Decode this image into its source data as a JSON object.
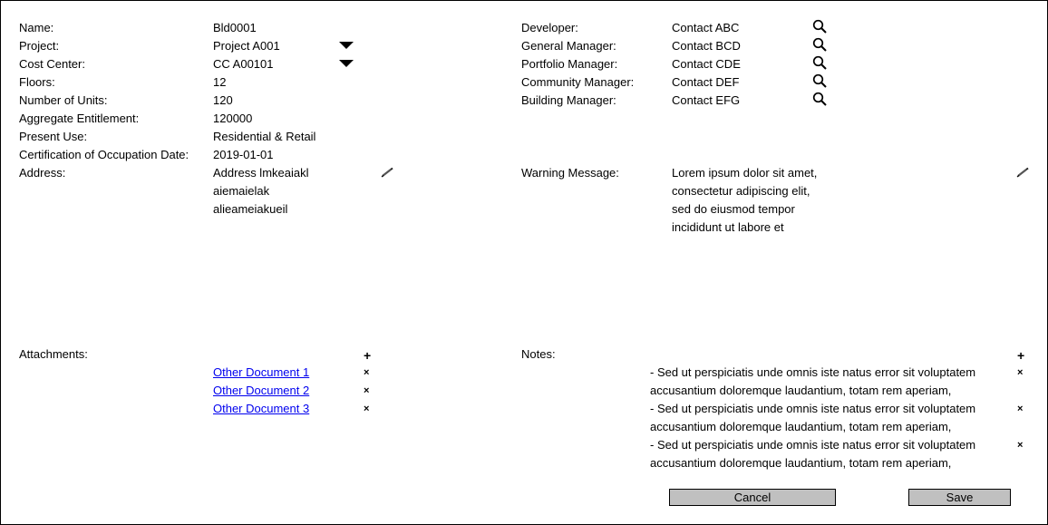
{
  "fields_left": [
    {
      "label": "Name:",
      "value": "Bld0001"
    },
    {
      "label": "Project:",
      "value": "Project A001"
    },
    {
      "label": "Cost Center:",
      "value": "CC A00101"
    },
    {
      "label": "Floors:",
      "value": "12"
    },
    {
      "label": "Number of Units:",
      "value": "120"
    },
    {
      "label": "Aggregate Entitlement:",
      "value": "120000"
    },
    {
      "label": "Present Use:",
      "value": "Residential & Retail"
    },
    {
      "label": "Certification of Occupation Date:",
      "value": "2019-01-01"
    }
  ],
  "address": {
    "label": "Address:",
    "lines": [
      "Address lmkeaiakl",
      "aiemaielak",
      "alieameiakueil"
    ]
  },
  "contacts": [
    {
      "label": "Developer:",
      "value": "Contact ABC",
      "icon": "search-icon"
    },
    {
      "label": "General Manager:",
      "value": "Contact BCD",
      "icon": "search-icon"
    },
    {
      "label": "Portfolio Manager:",
      "value": "Contact CDE",
      "icon": "search-icon"
    },
    {
      "label": "Community Manager:",
      "value": "Contact DEF",
      "icon": "search-icon"
    },
    {
      "label": "Building Manager:",
      "value": "Contact EFG",
      "icon": "search-icon"
    }
  ],
  "warning": {
    "label": "Warning Message:",
    "lines": [
      "Lorem ipsum dolor sit amet,",
      "consectetur adipiscing elit,",
      "sed do eiusmod tempor",
      "incididunt ut labore et"
    ]
  },
  "attachments": {
    "label": "Attachments:",
    "add_symbol": "+",
    "remove_symbol": "×",
    "items": [
      "Other Document 1",
      "Other Document 2",
      "Other Document 3"
    ]
  },
  "notes": {
    "label": "Notes:",
    "add_symbol": "+",
    "remove_symbol": "×",
    "items": [
      {
        "line1": "- Sed ut perspiciatis unde omnis iste natus error sit voluptatem",
        "line2": "accusantium doloremque laudantium, totam rem aperiam,"
      },
      {
        "line1": "- Sed ut perspiciatis unde omnis iste natus error sit voluptatem",
        "line2": "accusantium doloremque laudantium, totam rem aperiam,"
      },
      {
        "line1": "- Sed ut perspiciatis unde omnis iste natus error sit voluptatem",
        "line2": "accusantium doloremque laudantium, totam rem aperiam,"
      }
    ]
  },
  "buttons": {
    "cancel": "Cancel",
    "save": "Save"
  },
  "colors": {
    "link": "#0000ee",
    "button_bg": "#c0c0c0",
    "border": "#000000"
  }
}
